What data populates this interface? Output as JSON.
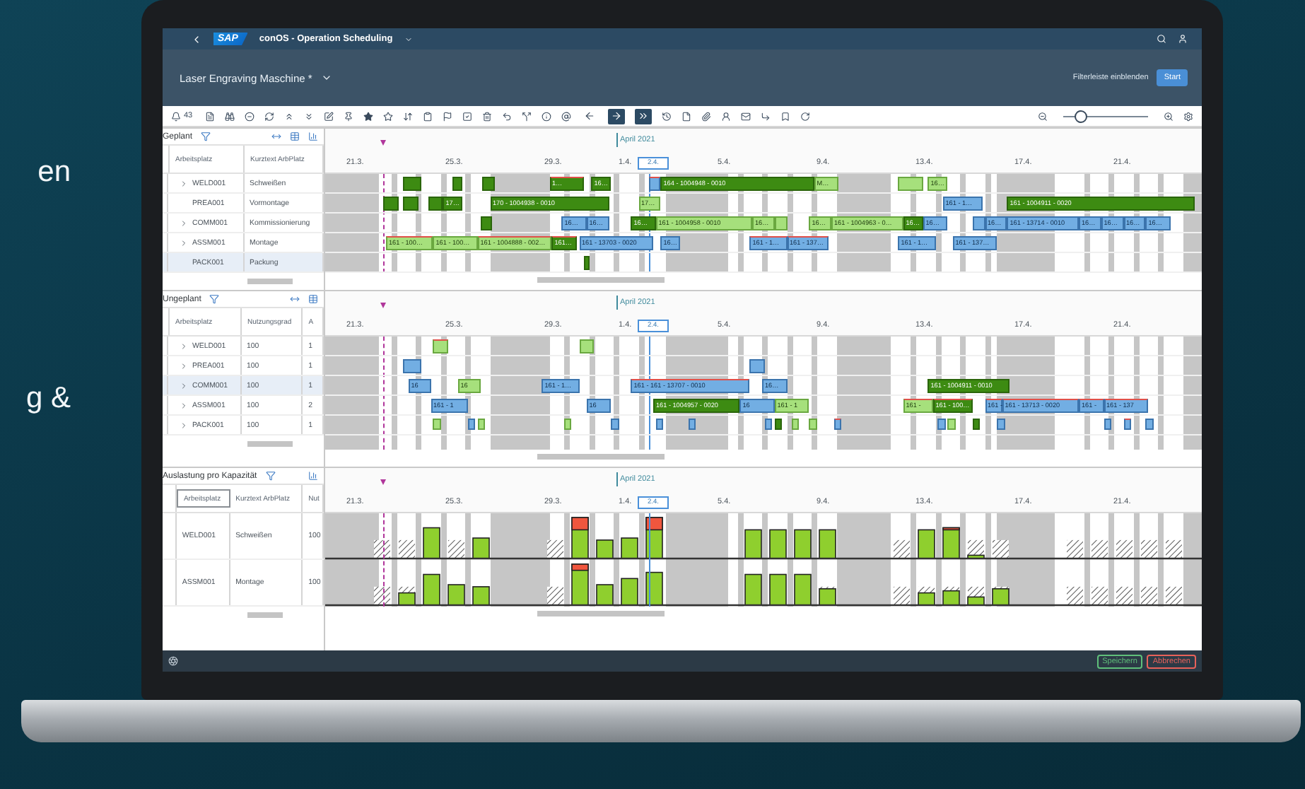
{
  "backdrop": {
    "lines": [
      "en",
      "g &"
    ]
  },
  "shell": {
    "logo": "SAP",
    "title": "conOS - Operation Scheduling"
  },
  "header": {
    "title": "Laser Engraving Maschine *",
    "filter_toggle": "Filterleiste einblenden",
    "start_button": "Start"
  },
  "toolbar": {
    "notification_count": "43",
    "nav": [
      {
        "selected": false
      },
      {
        "selected": true
      },
      {
        "selected": true
      }
    ],
    "zoom": {
      "level": 0.2
    }
  },
  "panels": [
    {
      "kind": "gantt",
      "title": "Geplant",
      "columns": [
        "Arbeitsplatz",
        "Kurztext ArbPlatz"
      ],
      "month": "April 2021",
      "dates": [
        "21.3.",
        "25.3.",
        "29.3.",
        "1.4.",
        "5.4.",
        "9.4.",
        "13.4.",
        "17.4.",
        "21.4."
      ],
      "today": "2.4.",
      "rows": [
        {
          "cells": [
            "WELD001",
            "Schweißen"
          ],
          "expandable": true,
          "selected": false,
          "bars": [
            {
              "kind": "released",
              "late": false
            },
            {
              "kind": "released",
              "late": false
            },
            {
              "kind": "released",
              "late": false
            },
            {
              "kind": "released",
              "label": "1…",
              "late": true
            },
            {
              "kind": "released",
              "label": "16…",
              "late": false
            },
            {
              "kind": "fixed",
              "late": true
            },
            {
              "kind": "released",
              "label": "164 - 1004948 - 0010",
              "late": false
            },
            {
              "kind": "planned",
              "label": "M…",
              "late": false
            },
            {
              "kind": "planned",
              "late": false
            },
            {
              "kind": "planned",
              "label": "16…",
              "late": false
            }
          ]
        },
        {
          "cells": [
            "PREA001",
            "Vormontage"
          ],
          "expandable": false,
          "selected": false,
          "bars": [
            {
              "kind": "released",
              "late": false
            },
            {
              "kind": "released",
              "late": false
            },
            {
              "kind": "released",
              "late": false
            },
            {
              "kind": "released",
              "label": "17…",
              "late": false
            },
            {
              "kind": "released",
              "label": "170 - 1004938 - 0010",
              "late": false
            },
            {
              "kind": "planned",
              "label": "17…",
              "late": false
            },
            {
              "kind": "fixed",
              "label": "161 - 1…",
              "late": false
            },
            {
              "kind": "released",
              "label": "161 - 1004911 - 0020",
              "late": false
            }
          ]
        },
        {
          "cells": [
            "COMM001",
            "Kommissionierung"
          ],
          "expandable": true,
          "selected": false,
          "bars": [
            {
              "kind": "released",
              "late": false
            },
            {
              "kind": "fixed",
              "label": "16…",
              "late": false
            },
            {
              "kind": "fixed",
              "label": "16…",
              "late": false
            },
            {
              "kind": "released",
              "label": "16…",
              "late": false
            },
            {
              "kind": "planned",
              "label": "161 - 1004958 - 0010",
              "late": false
            },
            {
              "kind": "planned",
              "label": "16…",
              "late": false
            },
            {
              "kind": "planned",
              "late": false
            },
            {
              "kind": "planned",
              "label": "16…",
              "late": false
            },
            {
              "kind": "planned",
              "label": "161 - 1004963 - 0…",
              "late": false
            },
            {
              "kind": "released",
              "label": "16…",
              "late": false
            },
            {
              "kind": "fixed",
              "label": "16…",
              "late": false
            },
            {
              "kind": "fixed",
              "late": false
            },
            {
              "kind": "fixed",
              "label": "16…",
              "late": false
            },
            {
              "kind": "fixed",
              "label": "161 - 13714 - 0010",
              "late": false
            },
            {
              "kind": "fixed",
              "label": "16…",
              "late": false
            },
            {
              "kind": "fixed",
              "label": "16…",
              "late": false
            },
            {
              "kind": "fixed",
              "label": "16…",
              "late": false
            },
            {
              "kind": "fixed",
              "label": "16…",
              "late": false
            }
          ]
        },
        {
          "cells": [
            "ASSM001",
            "Montage"
          ],
          "expandable": true,
          "selected": false,
          "bars": [
            {
              "kind": "planned",
              "label": "161 - 100…",
              "late": true
            },
            {
              "kind": "planned",
              "label": "161 - 100…",
              "late": false
            },
            {
              "kind": "planned",
              "label": "161 - 1004888 - 002…",
              "late": true
            },
            {
              "kind": "released",
              "label": "161…",
              "late": true
            },
            {
              "kind": "fixed",
              "label": "161 - 13703 - 0020",
              "late": false
            },
            {
              "kind": "fixed",
              "label": "16…",
              "late": false
            },
            {
              "kind": "fixed",
              "label": "161 - 1…",
              "late": true
            },
            {
              "kind": "fixed",
              "label": "161 - 137…",
              "late": true
            },
            {
              "kind": "fixed",
              "label": "161 - 1…",
              "late": false
            },
            {
              "kind": "fixed",
              "label": "161 - 137…",
              "late": false
            }
          ]
        },
        {
          "cells": [
            "PACK001",
            "Packung"
          ],
          "expandable": false,
          "selected": true,
          "bars": [
            {
              "kind": "released",
              "late": false
            }
          ]
        }
      ]
    },
    {
      "kind": "gantt",
      "title": "Ungeplant",
      "columns": [
        "Arbeitsplatz",
        "Nutzungsgrad",
        "A"
      ],
      "month": "April 2021",
      "dates": [
        "21.3.",
        "25.3.",
        "29.3.",
        "1.4.",
        "5.4.",
        "9.4.",
        "13.4.",
        "17.4.",
        "21.4."
      ],
      "today": "2.4.",
      "rows": [
        {
          "cells": [
            "WELD001",
            "100",
            "1"
          ],
          "expandable": true,
          "selected": false,
          "bars": [
            {
              "kind": "planned",
              "late": true
            },
            {
              "kind": "planned",
              "late": false
            }
          ]
        },
        {
          "cells": [
            "PREA001",
            "100",
            "1"
          ],
          "expandable": true,
          "selected": false,
          "bars": [
            {
              "kind": "fixed",
              "late": false
            },
            {
              "kind": "fixed",
              "late": false
            }
          ]
        },
        {
          "cells": [
            "COMM001",
            "100",
            "1"
          ],
          "expandable": true,
          "selected": true,
          "bars": [
            {
              "kind": "fixed",
              "label": "16",
              "late": false
            },
            {
              "kind": "planned",
              "label": "16",
              "late": false
            },
            {
              "kind": "fixed",
              "label": "161 - 1…",
              "late": false
            },
            {
              "kind": "fixed",
              "label": "161 - 161 - 13707 - 0010",
              "late": true
            },
            {
              "kind": "fixed",
              "label": "16…",
              "late": false
            },
            {
              "kind": "released",
              "label": "161 - 1004911 - 0010",
              "late": false
            }
          ]
        },
        {
          "cells": [
            "ASSM001",
            "100",
            "2"
          ],
          "expandable": true,
          "selected": false,
          "bars": [
            {
              "kind": "fixed",
              "label": "161 - 1",
              "late": false
            },
            {
              "kind": "fixed",
              "label": "16",
              "late": false
            },
            {
              "kind": "released",
              "label": "161 - 1004957 - 0020",
              "late": false
            },
            {
              "kind": "fixed",
              "label": "16",
              "late": false
            },
            {
              "kind": "planned",
              "label": "161 - 1",
              "late": false
            },
            {
              "kind": "planned",
              "label": "161 -",
              "late": true
            },
            {
              "kind": "released",
              "label": "161 - 100…",
              "late": true
            },
            {
              "kind": "fixed",
              "label": "161 -",
              "late": true
            },
            {
              "kind": "fixed",
              "label": "161 - 13713 - 0020",
              "late": true
            },
            {
              "kind": "fixed",
              "label": "161 -",
              "late": true
            },
            {
              "kind": "fixed",
              "label": "161 - 137",
              "late": true
            }
          ]
        },
        {
          "cells": [
            "PACK001",
            "100",
            "1"
          ],
          "expandable": true,
          "selected": false,
          "bars": [
            {
              "kind": "planned",
              "late": false
            },
            {
              "kind": "fixed",
              "late": false
            },
            {
              "kind": "planned",
              "late": false
            },
            {
              "kind": "planned",
              "late": false
            },
            {
              "kind": "fixed",
              "late": false
            },
            {
              "kind": "fixed",
              "late": false
            },
            {
              "kind": "fixed",
              "late": false
            },
            {
              "kind": "fixed",
              "late": false
            },
            {
              "kind": "released",
              "late": false
            },
            {
              "kind": "planned",
              "late": false
            },
            {
              "kind": "planned",
              "late": false
            },
            {
              "kind": "fixed",
              "late": true
            },
            {
              "kind": "fixed",
              "late": false
            },
            {
              "kind": "planned",
              "late": false
            },
            {
              "kind": "released",
              "late": false
            },
            {
              "kind": "fixed",
              "late": false
            },
            {
              "kind": "fixed",
              "late": false
            },
            {
              "kind": "fixed",
              "late": true
            },
            {
              "kind": "fixed",
              "late": false
            }
          ]
        }
      ]
    },
    {
      "kind": "capacity",
      "title": "Auslastung pro Kapazität",
      "columns": [
        "Arbeitsplatz",
        "Kurztext ArbPlatz",
        "Nut"
      ],
      "month": "April 2021",
      "dates": [
        "21.3.",
        "25.3.",
        "29.3.",
        "1.4.",
        "5.4.",
        "9.4.",
        "13.4.",
        "17.4.",
        "21.4."
      ],
      "today": "2.4.",
      "rows": [
        {
          "cells": [
            "WELD001",
            "Schweißen",
            "100"
          ],
          "selected": false
        },
        {
          "cells": [
            "ASSM001",
            "Montage",
            "100"
          ],
          "selected": false
        }
      ]
    }
  ],
  "footer": {
    "save_button": "Speichern",
    "cancel_button": "Abbrechen"
  }
}
